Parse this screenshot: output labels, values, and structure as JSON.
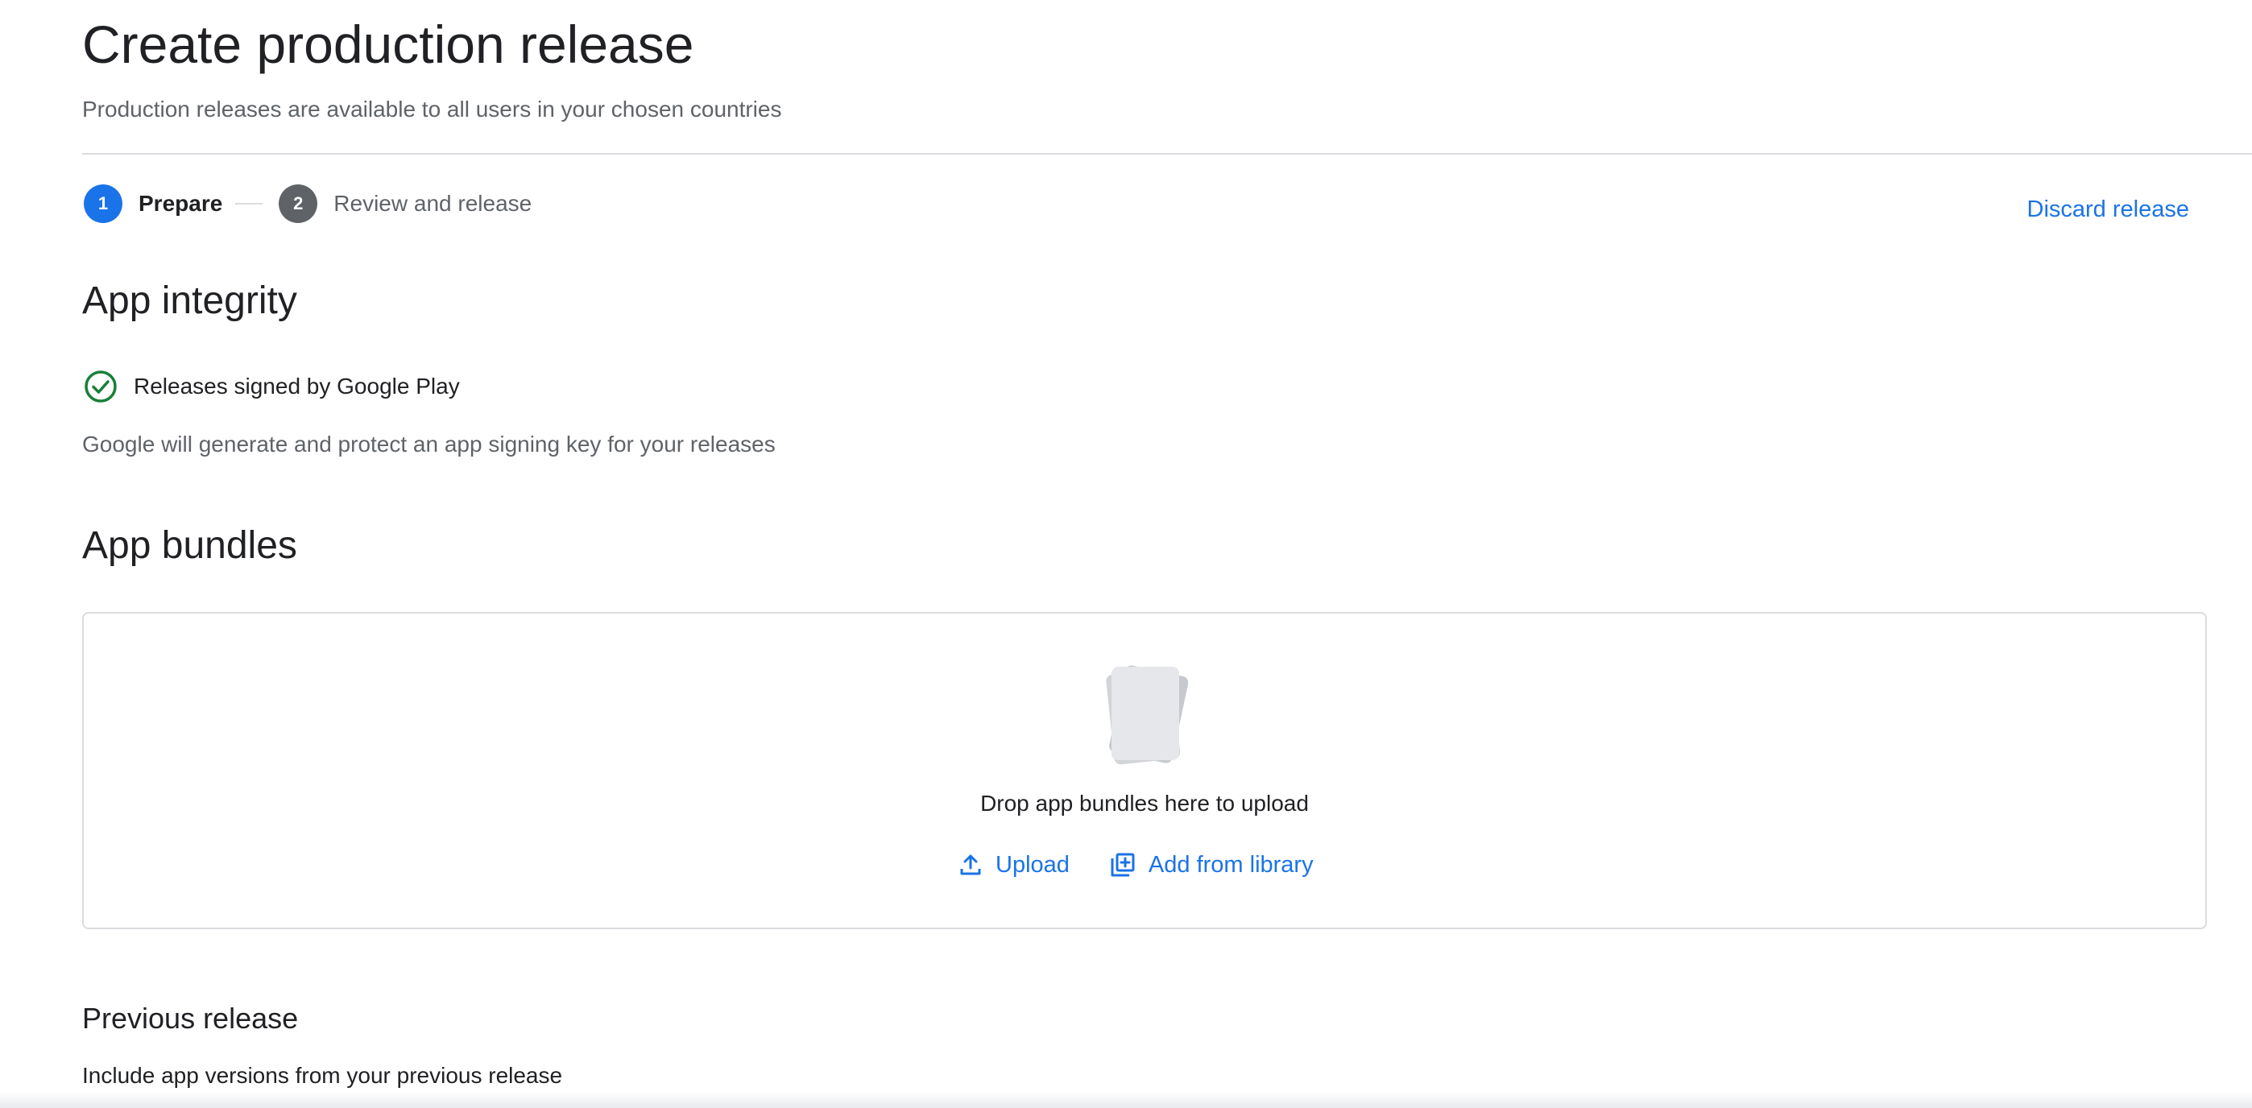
{
  "header": {
    "title": "Create production release",
    "subtitle": "Production releases are available to all users in your chosen countries"
  },
  "stepper": {
    "steps": [
      {
        "number": "1",
        "label": "Prepare",
        "state": "active"
      },
      {
        "number": "2",
        "label": "Review and release",
        "state": "inactive"
      }
    ],
    "discard_label": "Discard release"
  },
  "app_integrity": {
    "heading": "App integrity",
    "status_label": "Releases signed by Google Play",
    "status_icon": "check-circle-icon",
    "description": "Google will generate and protect an app signing key for your releases"
  },
  "app_bundles": {
    "heading": "App bundles",
    "drop_text": "Drop app bundles here to upload",
    "upload_label": "Upload",
    "upload_icon": "upload-icon",
    "library_label": "Add from library",
    "library_icon": "library-add-icon"
  },
  "previous_release": {
    "heading": "Previous release",
    "description": "Include app versions from your previous release"
  },
  "colors": {
    "accent": "#1a73e8",
    "success": "#188038",
    "text_primary": "#202124",
    "text_secondary": "#5f6368",
    "border": "#dadce0"
  }
}
